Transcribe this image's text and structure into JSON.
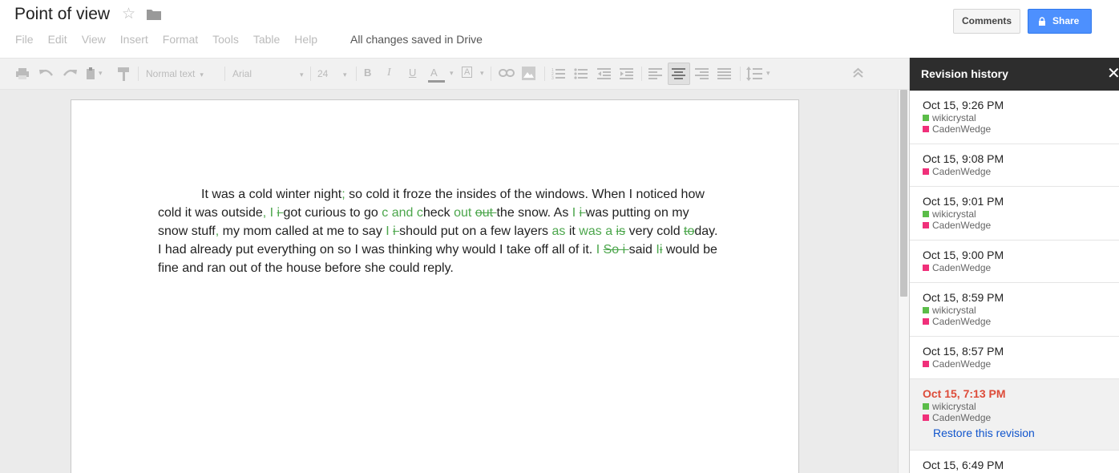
{
  "doc": {
    "title": "Point of view",
    "save_status": "All changes saved in Drive"
  },
  "menu": [
    "File",
    "Edit",
    "View",
    "Insert",
    "Format",
    "Tools",
    "Table",
    "Help"
  ],
  "buttons": {
    "comments": "Comments",
    "share": "Share"
  },
  "toolbar": {
    "style": "Normal text",
    "font": "Arial",
    "size": "24"
  },
  "body": {
    "line1": {
      "a": "It was a cold winter night",
      "b": ";",
      "c": " so cold it froze the insides of the windows. When I noticed"
    },
    "line2": {
      "a": "how cold it was outside",
      "b": ", I ",
      "c": "i ",
      "d": "got curious to go ",
      "e": "c and c",
      "f": "heck ",
      "g": "out ",
      "h": "out ",
      "i": "the snow. As ",
      "j": "I ",
      "k": "i ",
      "l": "was putting"
    },
    "line3": {
      "a": "on my snow stuff",
      "b": ", ",
      "c": " ",
      "d": "my mom called at me to say ",
      "e": "I ",
      "f": "i ",
      "g": "should put on a few layers ",
      "h": "as",
      "i": " it ",
      "j": "was a ",
      "k": "is"
    },
    "line4": {
      "a": "very cold ",
      "b": "to",
      "c": "day. I had already put everything on so I was thinking why would I take off all of"
    },
    "line5": {
      "a": "it. ",
      "b": "I ",
      "c": "So i ",
      "d": "said ",
      "e": "I",
      "f": "i",
      "g": " would be fine and ran out of the house before she could reply."
    }
  },
  "revision_panel": {
    "title": "Revision history",
    "close": "✕",
    "restore_label": "Restore this revision",
    "colors": {
      "wikicrystal": "#5bbd49",
      "CadenWedge": "#f0307a"
    },
    "items": [
      {
        "time": "Oct 15, 9:26 PM",
        "authors": [
          "wikicrystal",
          "CadenWedge"
        ]
      },
      {
        "time": "Oct 15, 9:08 PM",
        "authors": [
          "CadenWedge"
        ]
      },
      {
        "time": "Oct 15, 9:01 PM",
        "authors": [
          "wikicrystal",
          "CadenWedge"
        ]
      },
      {
        "time": "Oct 15, 9:00 PM",
        "authors": [
          "CadenWedge"
        ]
      },
      {
        "time": "Oct 15, 8:59 PM",
        "authors": [
          "wikicrystal",
          "CadenWedge"
        ]
      },
      {
        "time": "Oct 15, 8:57 PM",
        "authors": [
          "CadenWedge"
        ]
      },
      {
        "time": "Oct 15, 7:13 PM",
        "authors": [
          "wikicrystal",
          "CadenWedge"
        ],
        "selected": true
      },
      {
        "time": "Oct 15, 6:49 PM",
        "authors": [
          "CadenWedge"
        ]
      }
    ]
  }
}
